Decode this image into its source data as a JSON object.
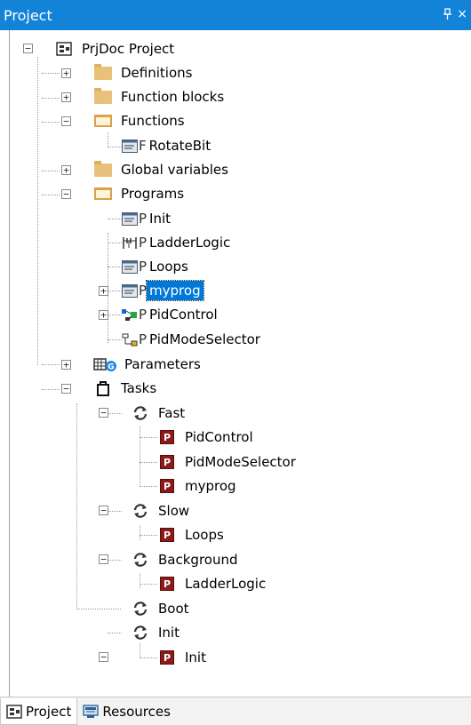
{
  "window": {
    "title": "Project",
    "pin_glyph": "↕",
    "close_glyph": "×"
  },
  "tree": {
    "root": "PrjDoc Project",
    "definitions": "Definitions",
    "function_blocks": "Function blocks",
    "functions": "Functions",
    "rotatebit": "RotateBit",
    "global_variables": "Global variables",
    "programs": "Programs",
    "prog_init": "Init",
    "prog_ladder": "LadderLogic",
    "prog_loops": "Loops",
    "prog_myprog": "myprog",
    "prog_pidcontrol": "PidControl",
    "prog_pidmode": "PidModeSelector",
    "parameters": "Parameters",
    "tasks": "Tasks",
    "task_fast": "Fast",
    "fast_pidcontrol": "PidControl",
    "fast_pidmode": "PidModeSelector",
    "fast_myprog": "myprog",
    "task_slow": "Slow",
    "slow_loops": "Loops",
    "task_background": "Background",
    "bg_ladder": "LadderLogic",
    "task_boot": "Boot",
    "task_init": "Init",
    "init_init": "Init",
    "pou_letter_f": "F",
    "pou_letter_p": "P",
    "badge_letter": "P",
    "expanded_glyph": "−",
    "collapsed_glyph": "+"
  },
  "tabs": {
    "project": "Project",
    "resources": "Resources"
  },
  "icons": {
    "folder": "folder-icon",
    "folder_open": "folder-open-icon",
    "project": "project-icon",
    "st_program": "st-program-icon",
    "ladder_program": "ladder-program-icon",
    "fbd_program": "fbd-program-icon",
    "sfc_program": "sfc-program-icon",
    "parameters": "parameters-icon",
    "tasks": "tasks-icon",
    "task": "task-cycle-icon",
    "program_instance": "program-instance-icon"
  },
  "colors": {
    "accent": "#1383d8",
    "selection": "#0078d7",
    "folder": "#e8c27a",
    "instance_badge": "#8b1a1a"
  }
}
